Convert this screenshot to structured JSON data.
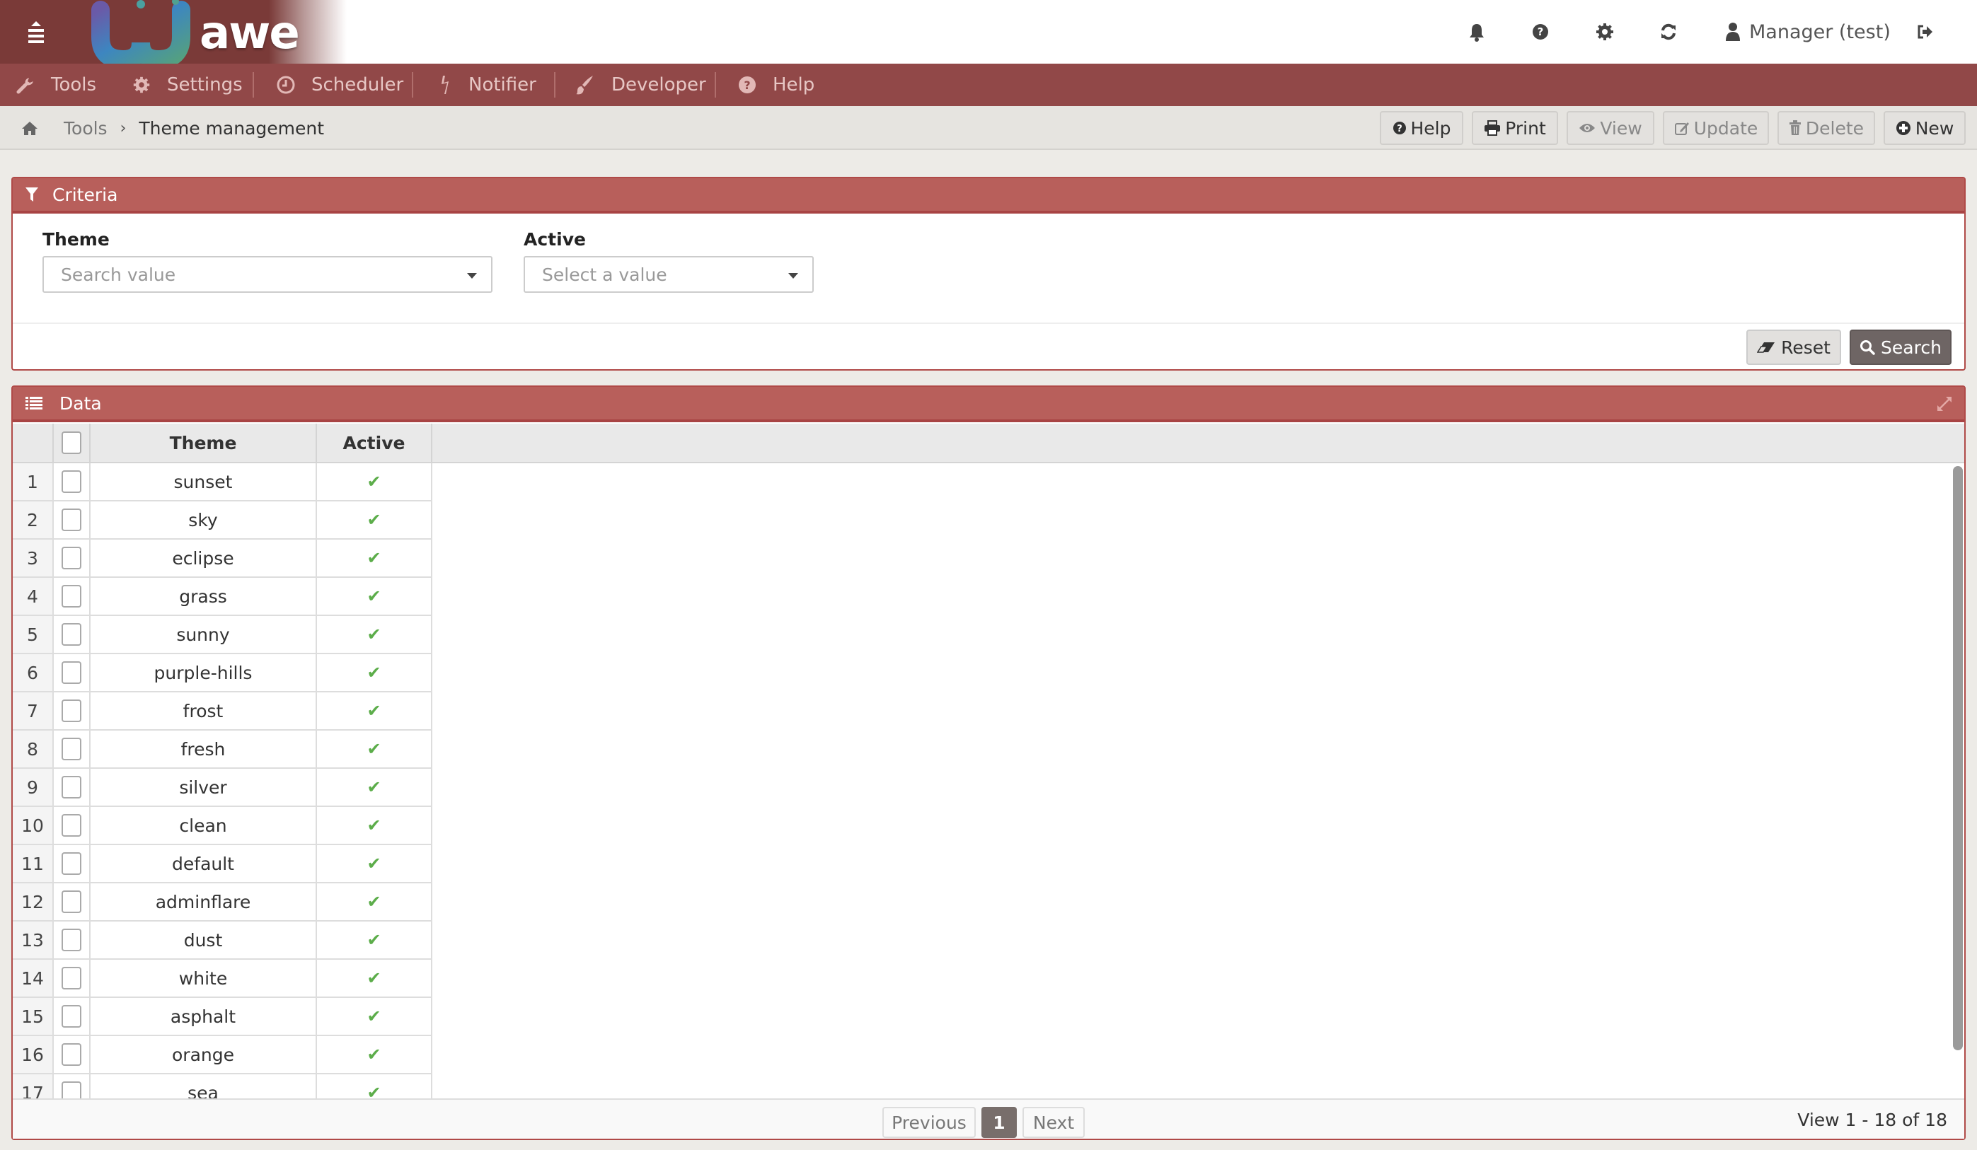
{
  "header": {
    "logo_text": "awe",
    "user_name": "Manager (test)",
    "icons": [
      "bell-icon",
      "question-circle-icon",
      "gear-icon",
      "refresh-icon",
      "user-icon",
      "logout-icon"
    ]
  },
  "nav": {
    "items": [
      {
        "label": "Tools",
        "icon": "wrench-icon"
      },
      {
        "label": "Settings",
        "icon": "gear-icon"
      },
      {
        "label": "Scheduler",
        "icon": "clock-icon"
      },
      {
        "label": "Notifier",
        "icon": "bolt-icon"
      },
      {
        "label": "Developer",
        "icon": "paintbrush-icon"
      },
      {
        "label": "Help",
        "icon": "question-circle-icon"
      }
    ]
  },
  "breadcrumb": {
    "home_icon": "home-icon",
    "items": [
      "Tools",
      "Theme management"
    ]
  },
  "toolbar": {
    "help": "Help",
    "print": "Print",
    "view": "View",
    "update": "Update",
    "delete": "Delete",
    "new": "New"
  },
  "criteria": {
    "title": "Criteria",
    "theme_label": "Theme",
    "theme_placeholder": "Search value",
    "active_label": "Active",
    "active_placeholder": "Select a value",
    "reset": "Reset",
    "search": "Search"
  },
  "data_panel": {
    "title": "Data",
    "columns": [
      "Theme",
      "Active"
    ],
    "rows": [
      {
        "n": "1",
        "theme": "sunset",
        "active": true
      },
      {
        "n": "2",
        "theme": "sky",
        "active": true
      },
      {
        "n": "3",
        "theme": "eclipse",
        "active": true
      },
      {
        "n": "4",
        "theme": "grass",
        "active": true
      },
      {
        "n": "5",
        "theme": "sunny",
        "active": true
      },
      {
        "n": "6",
        "theme": "purple-hills",
        "active": true
      },
      {
        "n": "7",
        "theme": "frost",
        "active": true
      },
      {
        "n": "8",
        "theme": "fresh",
        "active": true
      },
      {
        "n": "9",
        "theme": "silver",
        "active": true
      },
      {
        "n": "10",
        "theme": "clean",
        "active": true
      },
      {
        "n": "11",
        "theme": "default",
        "active": true
      },
      {
        "n": "12",
        "theme": "adminflare",
        "active": true
      },
      {
        "n": "13",
        "theme": "dust",
        "active": true
      },
      {
        "n": "14",
        "theme": "white",
        "active": true
      },
      {
        "n": "15",
        "theme": "asphalt",
        "active": true
      },
      {
        "n": "16",
        "theme": "orange",
        "active": true
      },
      {
        "n": "17",
        "theme": "sea",
        "active": true
      }
    ],
    "pagination": {
      "previous": "Previous",
      "current_page": "1",
      "next": "Next",
      "view_info": "View 1 - 18 of 18"
    }
  },
  "colors": {
    "nav_bg": "#914848",
    "panel_header": "#b85f5b",
    "check_green": "#5cad4a",
    "search_button": "#6e6564"
  }
}
